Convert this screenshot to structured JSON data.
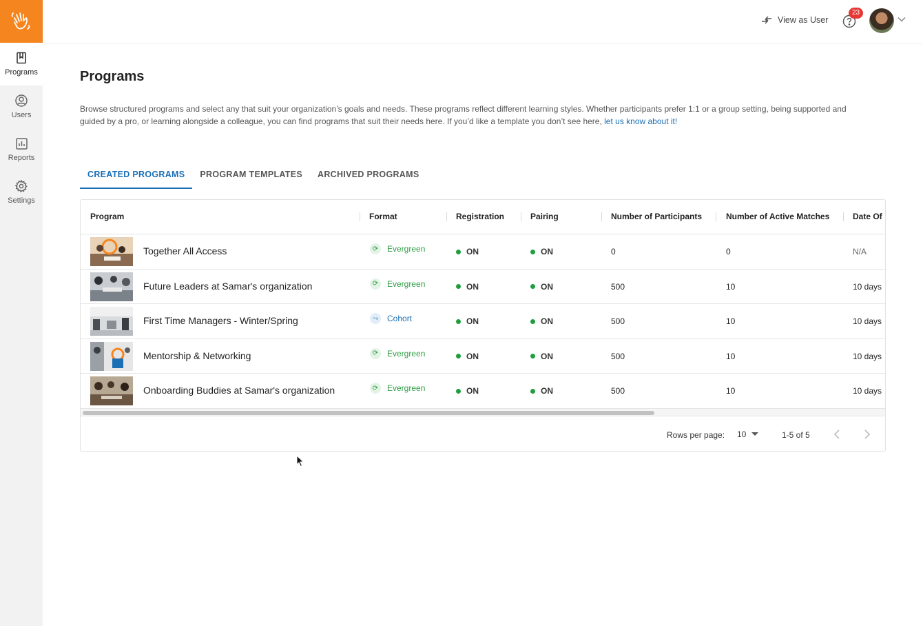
{
  "nav": {
    "items": [
      {
        "label": "Programs",
        "icon": "book-icon",
        "active": true
      },
      {
        "label": "Users",
        "icon": "user-circle-icon",
        "active": false
      },
      {
        "label": "Reports",
        "icon": "bar-chart-icon",
        "active": false
      },
      {
        "label": "Settings",
        "icon": "gear-icon",
        "active": false
      }
    ],
    "brand_color": "#f5861f"
  },
  "topbar": {
    "view_as_user": "View as User",
    "help_badge_count": "23"
  },
  "page": {
    "title": "Programs",
    "description": "Browse structured programs and select any that suit your organization’s goals and needs. These programs reflect different learning styles. Whether participants prefer 1:1 or a group setting, being supported and guided by a pro, or learning alongside a colleague, you can find programs that suit their needs here. If you’d like a template you don’t see here, ",
    "description_link": "let us know about it!"
  },
  "tabs": [
    {
      "label": "CREATED PROGRAMS",
      "active": true
    },
    {
      "label": "PROGRAM TEMPLATES",
      "active": false
    },
    {
      "label": "ARCHIVED PROGRAMS",
      "active": false
    }
  ],
  "table": {
    "columns": [
      "Program",
      "Format",
      "Registration",
      "Pairing",
      "Number of Participants",
      "Number of Active Matches",
      "Date Of"
    ],
    "rows": [
      {
        "program": "Together All Access",
        "format": "Evergreen",
        "registration": "ON",
        "pairing": "ON",
        "participants": "0",
        "matches": "0",
        "date": "N/A"
      },
      {
        "program": "Future Leaders at Samar's organization",
        "format": "Evergreen",
        "registration": "ON",
        "pairing": "ON",
        "participants": "500",
        "matches": "10",
        "date": "10 days"
      },
      {
        "program": "First Time Managers - Winter/Spring",
        "format": "Cohort",
        "registration": "ON",
        "pairing": "ON",
        "participants": "500",
        "matches": "10",
        "date": "10 days"
      },
      {
        "program": "Mentorship & Networking",
        "format": "Evergreen",
        "registration": "ON",
        "pairing": "ON",
        "participants": "500",
        "matches": "10",
        "date": "10 days"
      },
      {
        "program": "Onboarding Buddies at Samar's organization",
        "format": "Evergreen",
        "registration": "ON",
        "pairing": "ON",
        "participants": "500",
        "matches": "10",
        "date": "10 days"
      }
    ]
  },
  "pagination": {
    "rows_per_page_label": "Rows per page:",
    "rows_per_page_value": "10",
    "range": "1-5 of 5"
  }
}
